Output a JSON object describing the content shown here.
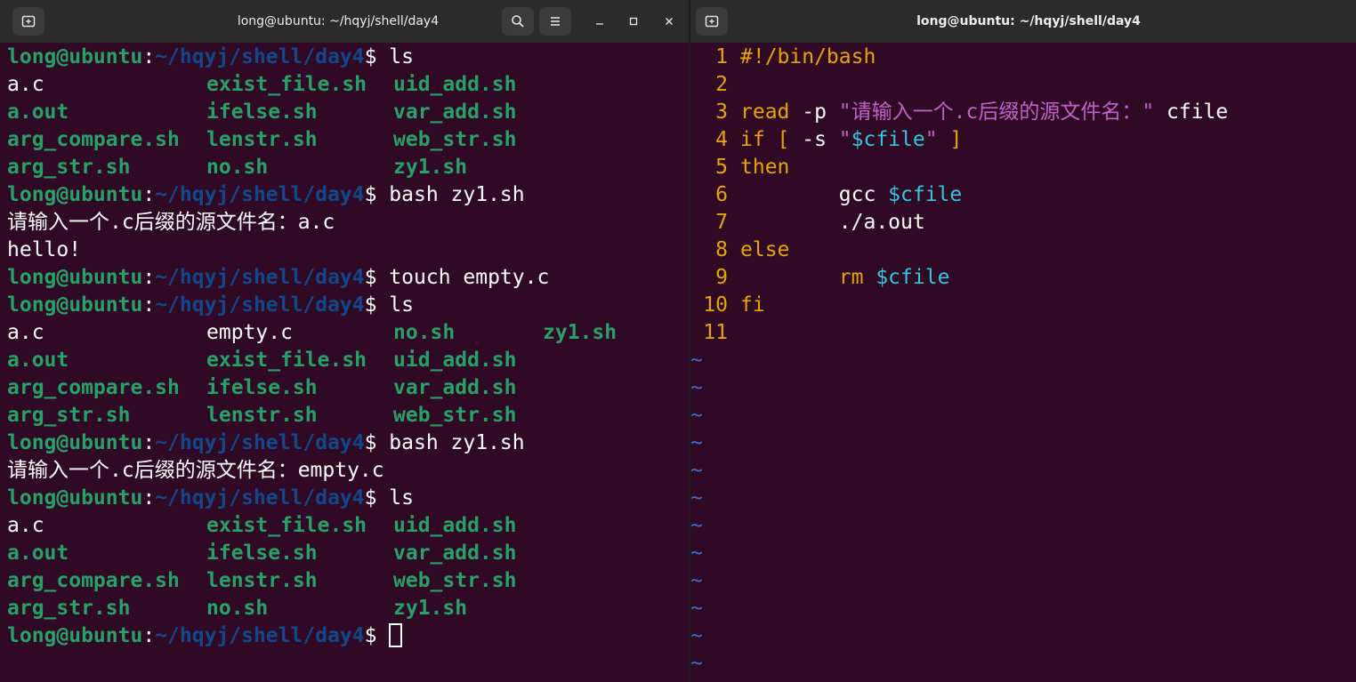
{
  "left_window": {
    "title": "long@ubuntu: ~/hqyj/shell/day4",
    "icons": [
      "new-tab-icon",
      "search-icon",
      "menu-icon",
      "minimize-icon",
      "maximize-icon",
      "close-icon"
    ],
    "prompt": {
      "user": "long@ubuntu",
      "sep": ":",
      "path": "~/hqyj/shell/day4",
      "sym": "$"
    },
    "lines": [
      {
        "type": "prompt",
        "cmd": " ls"
      },
      {
        "type": "ls",
        "cells": [
          [
            "a.c",
            "w"
          ],
          [
            "exist_file.sh",
            "g"
          ],
          [
            "uid_add.sh",
            "g"
          ]
        ]
      },
      {
        "type": "ls",
        "cells": [
          [
            "a.out",
            "g"
          ],
          [
            "ifelse.sh",
            "g"
          ],
          [
            "var_add.sh",
            "g"
          ]
        ]
      },
      {
        "type": "ls",
        "cells": [
          [
            "arg_compare.sh",
            "g"
          ],
          [
            "lenstr.sh",
            "g"
          ],
          [
            "web_str.sh",
            "g"
          ]
        ]
      },
      {
        "type": "ls",
        "cells": [
          [
            "arg_str.sh",
            "g"
          ],
          [
            "no.sh",
            "g"
          ],
          [
            "zy1.sh",
            "g"
          ]
        ]
      },
      {
        "type": "prompt",
        "cmd": " bash zy1.sh"
      },
      {
        "type": "text",
        "text": "请输入一个.c后缀的源文件名：a.c"
      },
      {
        "type": "text",
        "text": "hello!"
      },
      {
        "type": "prompt",
        "cmd": " touch empty.c"
      },
      {
        "type": "prompt",
        "cmd": " ls"
      },
      {
        "type": "ls",
        "cells": [
          [
            "a.c",
            "w"
          ],
          [
            "empty.c",
            "w"
          ],
          [
            "no.sh",
            "g"
          ],
          [
            "zy1.sh",
            "g"
          ]
        ]
      },
      {
        "type": "ls",
        "cells": [
          [
            "a.out",
            "g"
          ],
          [
            "exist_file.sh",
            "g"
          ],
          [
            "uid_add.sh",
            "g"
          ]
        ]
      },
      {
        "type": "ls",
        "cells": [
          [
            "arg_compare.sh",
            "g"
          ],
          [
            "ifelse.sh",
            "g"
          ],
          [
            "var_add.sh",
            "g"
          ]
        ]
      },
      {
        "type": "ls",
        "cells": [
          [
            "arg_str.sh",
            "g"
          ],
          [
            "lenstr.sh",
            "g"
          ],
          [
            "web_str.sh",
            "g"
          ]
        ]
      },
      {
        "type": "prompt",
        "cmd": " bash zy1.sh"
      },
      {
        "type": "text",
        "text": "请输入一个.c后缀的源文件名：empty.c"
      },
      {
        "type": "prompt",
        "cmd": " ls"
      },
      {
        "type": "ls",
        "cells": [
          [
            "a.c",
            "w"
          ],
          [
            "exist_file.sh",
            "g"
          ],
          [
            "uid_add.sh",
            "g"
          ]
        ]
      },
      {
        "type": "ls",
        "cells": [
          [
            "a.out",
            "g"
          ],
          [
            "ifelse.sh",
            "g"
          ],
          [
            "var_add.sh",
            "g"
          ]
        ]
      },
      {
        "type": "ls",
        "cells": [
          [
            "arg_compare.sh",
            "g"
          ],
          [
            "lenstr.sh",
            "g"
          ],
          [
            "web_str.sh",
            "g"
          ]
        ]
      },
      {
        "type": "ls",
        "cells": [
          [
            "arg_str.sh",
            "g"
          ],
          [
            "no.sh",
            "g"
          ],
          [
            "zy1.sh",
            "g"
          ]
        ]
      },
      {
        "type": "prompt",
        "cmd": " ",
        "cursor": true
      }
    ]
  },
  "right_window": {
    "title": "long@ubuntu: ~/hqyj/shell/day4",
    "code": [
      {
        "n": "1",
        "tokens": [
          [
            "#!/bin/bash",
            "kw"
          ]
        ]
      },
      {
        "n": "2",
        "tokens": []
      },
      {
        "n": "3",
        "tokens": [
          [
            "read",
            "kw"
          ],
          [
            " -p ",
            "txt"
          ],
          [
            "\"请输入一个.c后缀的源文件名：\"",
            "str"
          ],
          [
            " cfile",
            "txt"
          ]
        ]
      },
      {
        "n": "4",
        "tokens": [
          [
            "if [",
            "kw"
          ],
          [
            " -s ",
            "txt"
          ],
          [
            "\"",
            "str"
          ],
          [
            "$cfile",
            "var"
          ],
          [
            "\"",
            "str"
          ],
          [
            " ]",
            "kw"
          ]
        ]
      },
      {
        "n": "5",
        "tokens": [
          [
            "then",
            "kw"
          ]
        ]
      },
      {
        "n": "6",
        "tokens": [
          [
            "        gcc ",
            "txt"
          ],
          [
            "$cfile",
            "var"
          ]
        ]
      },
      {
        "n": "7",
        "tokens": [
          [
            "        ./a.out",
            "txt"
          ]
        ]
      },
      {
        "n": "8",
        "tokens": [
          [
            "else",
            "kw"
          ]
        ]
      },
      {
        "n": "9",
        "tokens": [
          [
            "        rm ",
            "kw"
          ],
          [
            "$cfile",
            "var"
          ]
        ]
      },
      {
        "n": "10",
        "tokens": [
          [
            "fi",
            "kw"
          ]
        ]
      },
      {
        "n": "11",
        "tokens": []
      }
    ],
    "tilde_marker": "~",
    "tilde_count": 12
  },
  "colors": {
    "background": "#300a24",
    "titlebar": "#2b2b2b",
    "user_green": "#26a269",
    "path_blue": "#12488b",
    "keyword_yellow": "#e5a50a",
    "string_magenta": "#c061cb",
    "variable_cyan": "#33c7de",
    "tilde_blue": "#3b6fd1"
  }
}
